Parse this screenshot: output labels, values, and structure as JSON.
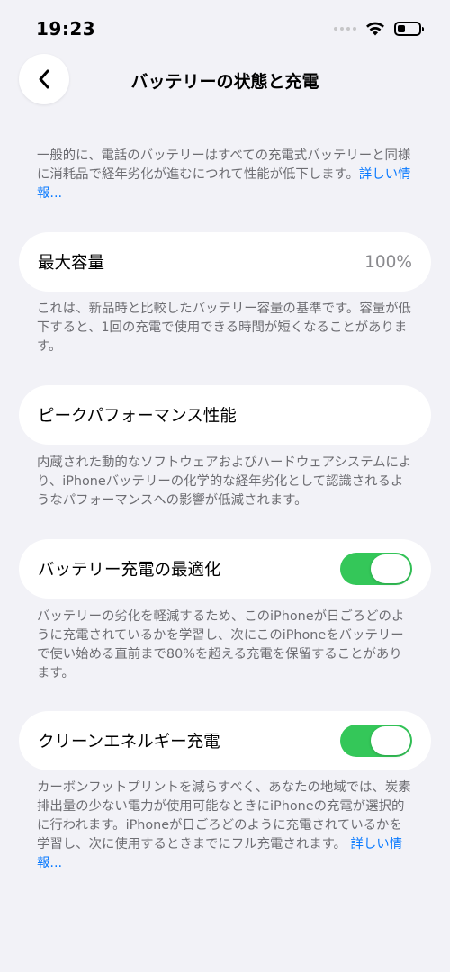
{
  "status_bar": {
    "time": "19:23",
    "wifi_icon": "wifi-icon",
    "battery_icon": "battery-icon"
  },
  "nav": {
    "title": "バッテリーの状態と充電",
    "back_icon": "chevron-left-icon"
  },
  "intro": {
    "text": "一般的に、電話のバッテリーはすべての充電式バッテリーと同様に消耗品で経年劣化が進むにつれて性能が低下します。",
    "link": "詳しい情報..."
  },
  "max_capacity": {
    "label": "最大容量",
    "value": "100%",
    "description": "これは、新品時と比較したバッテリー容量の基準です。容量が低下すると、1回の充電で使用できる時間が短くなることがあります。"
  },
  "peak_performance": {
    "label": "ピークパフォーマンス性能",
    "description": "内蔵された動的なソフトウェアおよびハードウェアシステムにより、iPhoneバッテリーの化学的な経年劣化として認識されるようなパフォーマンスへの影響が低減されます。"
  },
  "optimized_charging": {
    "label": "バッテリー充電の最適化",
    "on": true,
    "description": "バッテリーの劣化を軽減するため、このiPhoneが日ごろどのように充電されているかを学習し、次にこのiPhoneをバッテリーで使い始める直前まで80%を超える充電を保留することがあります。"
  },
  "clean_energy": {
    "label": "クリーンエネルギー充電",
    "on": true,
    "description": "カーボンフットプリントを減らすべく、あなたの地域では、炭素排出量の少ない電力が使用可能なときにiPhoneの充電が選択的に行われます。iPhoneが日ごろどのように充電されているかを学習し、次に使用するときまでにフル充電されます。",
    "link": "詳しい情報..."
  },
  "colors": {
    "accent": "#0a7aff",
    "toggle_on": "#34c759",
    "background": "#f2f2f7"
  }
}
